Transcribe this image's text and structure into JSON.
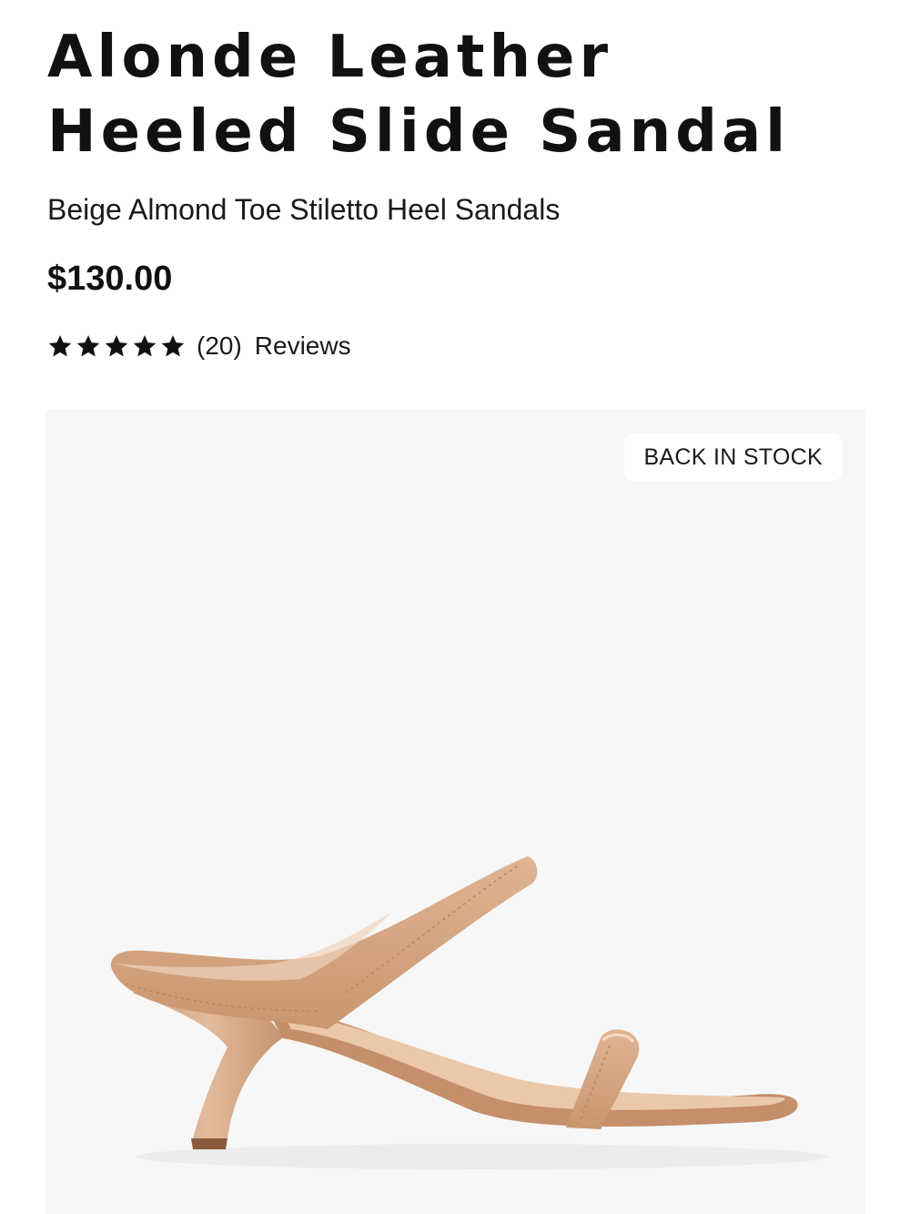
{
  "product": {
    "title_line1": "Alonde Leather",
    "title_line2": "Heeled Slide Sandal",
    "subtitle": "Beige Almond Toe Stiletto Heel Sandals",
    "price": "$130.00",
    "rating": {
      "stars": 5,
      "max_stars": 5,
      "count": "(20)",
      "reviews_label": "Reviews"
    },
    "image": {
      "badge": "BACK IN STOCK",
      "background_color": "#f7f7f7",
      "product_color": "#d7a987"
    }
  }
}
